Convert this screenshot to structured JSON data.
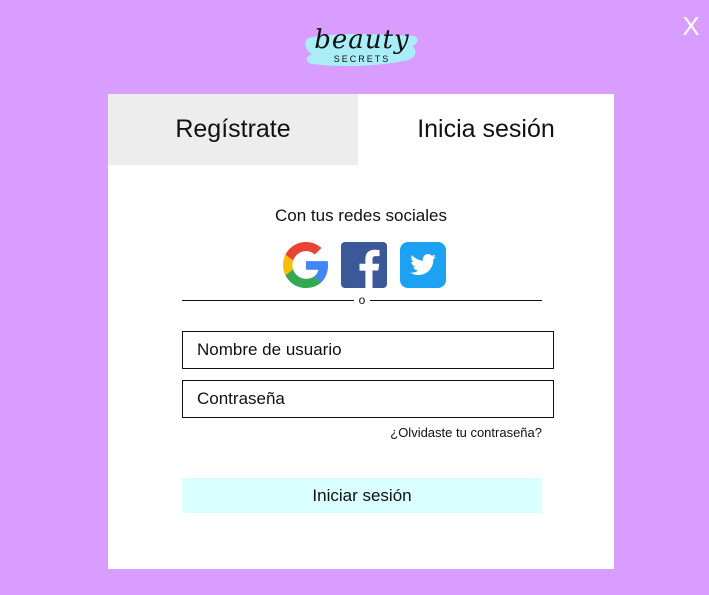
{
  "close_label": "X",
  "logo": {
    "script_text": "beauty",
    "sub_text": "SECRETS"
  },
  "tabs": {
    "register": "Regístrate",
    "login": "Inicia sesión"
  },
  "social": {
    "caption": "Con tus redes sociales",
    "providers": [
      "google-icon",
      "facebook-icon",
      "twitter-icon"
    ]
  },
  "divider_text": "o",
  "form": {
    "username_placeholder": "Nombre de usuario",
    "password_placeholder": "Contraseña",
    "forgot_label": "¿Olvidaste tu contraseña?",
    "submit_label": "Iniciar sesión"
  },
  "colors": {
    "background": "#d99cff",
    "card": "#ffffff",
    "inactive_tab": "#ededed",
    "submit_button": "#d9ffff",
    "logo_swash": "#a9eef7",
    "facebook": "#3b5998",
    "twitter": "#1da1f2"
  }
}
